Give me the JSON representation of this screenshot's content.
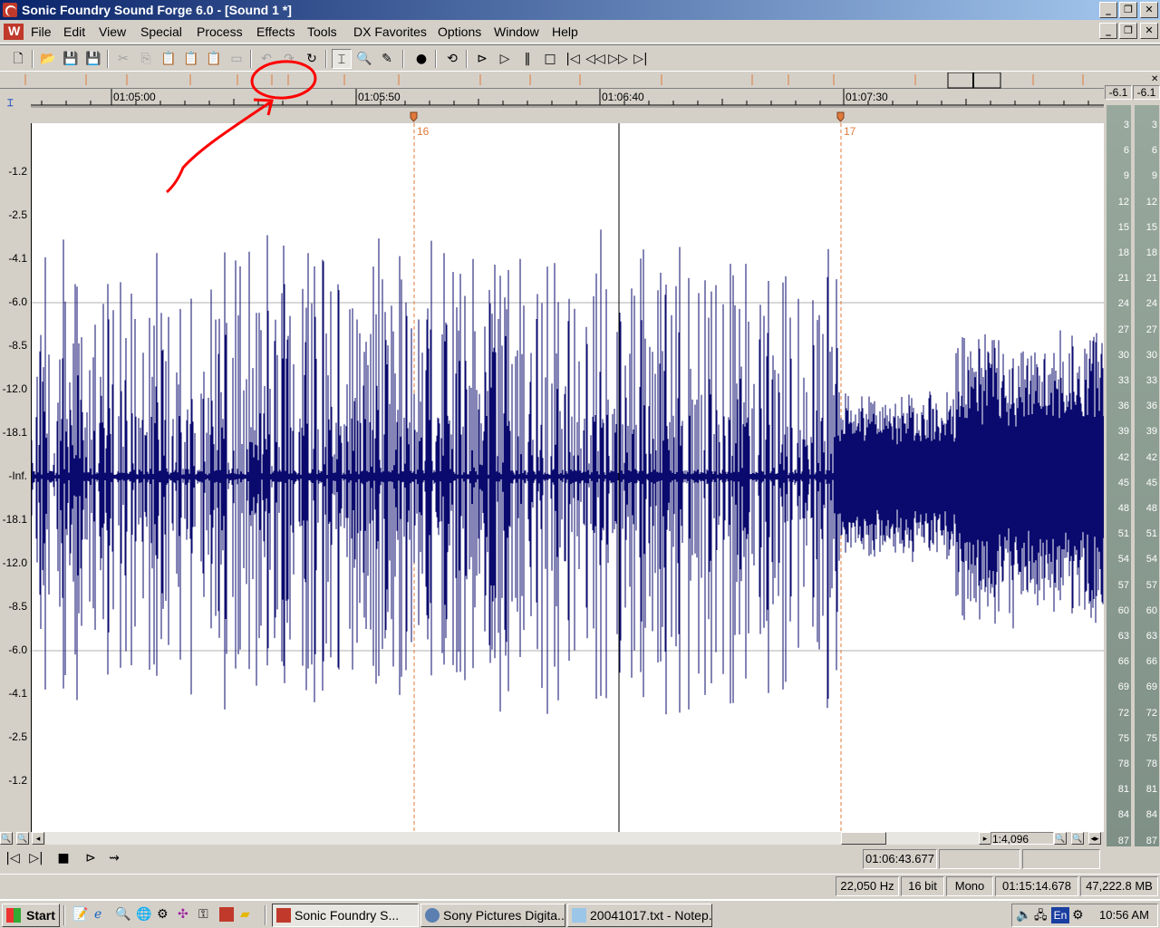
{
  "window": {
    "title": "Sonic Foundry Sound Forge 6.0 - [Sound 1 *]",
    "caption_buttons": [
      "_",
      "❐",
      "✕"
    ],
    "doc_buttons": [
      "_",
      "❐",
      "✕"
    ]
  },
  "menu": {
    "items": [
      "File",
      "Edit",
      "View",
      "Special",
      "Process",
      "Effects",
      "Tools",
      "DX Favorites",
      "Options",
      "Window",
      "Help"
    ]
  },
  "toolbar": {
    "icons": [
      "new-icon",
      "open-icon",
      "save-icon",
      "save-as-icon",
      "cut-icon",
      "copy-icon",
      "paste-icon",
      "mix-icon",
      "crop-icon",
      "trim-icon",
      "undo-icon",
      "redo-icon",
      "repeat-icon",
      "edit-tool-icon",
      "magnify-tool-icon",
      "pencil-tool-icon",
      "record-icon",
      "loop-icon",
      "play-all-icon",
      "play-icon",
      "pause-icon",
      "stop-icon",
      "go-start-icon",
      "rewind-icon",
      "forward-icon",
      "go-end-icon"
    ]
  },
  "ruler": {
    "ticks": [
      "01:05:00",
      "01:05:50",
      "01:06:40",
      "01:07:30"
    ],
    "markers": [
      "16",
      "17"
    ]
  },
  "db_scale": [
    "-1.2",
    "-2.5",
    "-4.1",
    "-6.0",
    "-8.5",
    "-12.0",
    "-18.1",
    "-Inf.",
    "-18.1",
    "-12.0",
    "-8.5",
    "-6.0",
    "-4.1",
    "-2.5",
    "-1.2"
  ],
  "meter": {
    "peak_left": "-6.1",
    "peak_right": "-6.1",
    "labels": [
      "3",
      "6",
      "9",
      "12",
      "15",
      "18",
      "21",
      "24",
      "27",
      "30",
      "33",
      "36",
      "39",
      "42",
      "45",
      "48",
      "51",
      "54",
      "57",
      "60",
      "63",
      "66",
      "69",
      "72",
      "75",
      "78",
      "81",
      "84",
      "87"
    ]
  },
  "zoom": {
    "ratio": "1:4,096"
  },
  "transport": {
    "cursor_position": "01:06:43.677"
  },
  "status": {
    "sample_rate": "22,050 Hz",
    "bit_depth": "16 bit",
    "channels": "Mono",
    "length": "01:15:14.678",
    "disk_space": "47,222.8 MB"
  },
  "taskbar": {
    "start": "Start",
    "tasks": [
      "Sonic Foundry S...",
      "Sony Pictures Digita...",
      "20041017.txt - Notep..."
    ],
    "language": "En",
    "clock": "10:56 AM"
  },
  "colors": {
    "waveform": "#0a0a6e",
    "annotation": "#ff0000",
    "marker": "#e07a3a"
  }
}
